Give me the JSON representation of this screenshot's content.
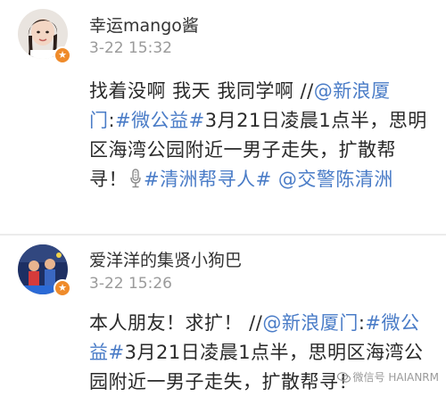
{
  "posts": [
    {
      "username": "幸运mango酱",
      "timestamp": "3-22 15:32",
      "badge_icon": "verified-badge-icon",
      "segments": [
        {
          "text": "找着没啊 我天 我同学啊 //",
          "link": false
        },
        {
          "text": "@新浪厦门",
          "link": true
        },
        {
          "text": ":",
          "link": false
        },
        {
          "text": "#微公益#",
          "link": true
        },
        {
          "text": "3月21日凌晨1点半，思明区海湾公园附近一男子走失，扩散帮寻！",
          "link": false
        },
        {
          "text": "#清洲帮寻人#",
          "link": true,
          "mic_before": true
        },
        {
          "text": " ",
          "link": false
        },
        {
          "text": "@交警陈清洲",
          "link": true
        }
      ]
    },
    {
      "username": "爱洋洋的集贤小狗巴",
      "timestamp": "3-22 15:26",
      "badge_icon": "verified-badge-icon",
      "segments": [
        {
          "text": "本人朋友！求扩！ //",
          "link": false
        },
        {
          "text": "@新浪厦门",
          "link": true
        },
        {
          "text": ":",
          "link": false
        },
        {
          "text": "#微公益#",
          "link": true
        },
        {
          "text": "3月21日凌晨1点半，思明区海湾公园附近一男子走失，扩散帮寻！",
          "link": false
        }
      ]
    }
  ],
  "watermark": {
    "text": "微信号 HAIANRM",
    "icon": "wechat-icon"
  },
  "colors": {
    "link": "#4a7cc7",
    "text": "#2a2a2a",
    "timestamp": "#9a9a9a",
    "badge": "#ef8b2b"
  }
}
